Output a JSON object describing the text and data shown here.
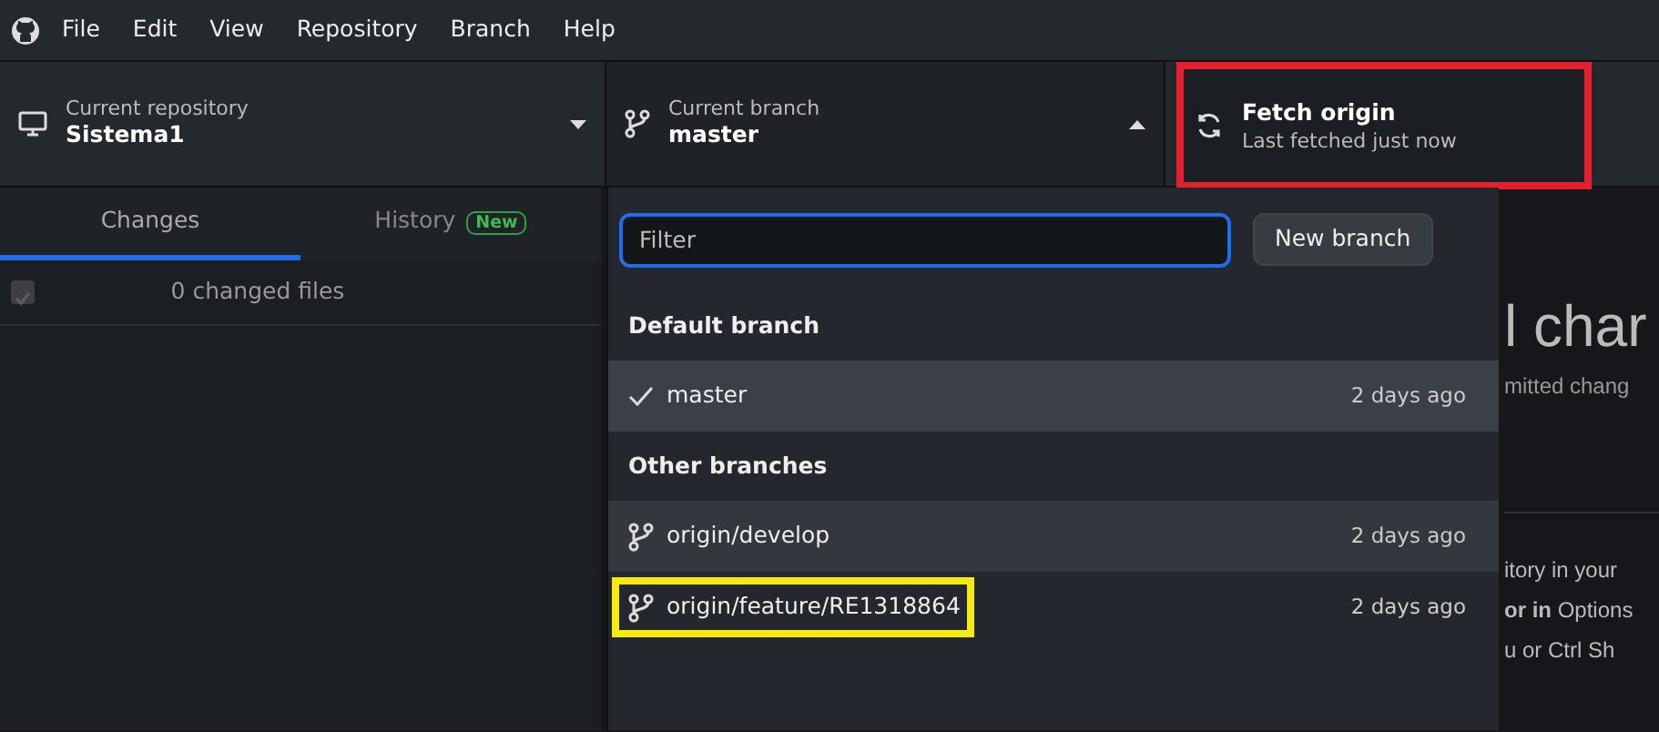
{
  "menu": [
    "File",
    "Edit",
    "View",
    "Repository",
    "Branch",
    "Help"
  ],
  "toolbar": {
    "repository": {
      "label": "Current repository",
      "value": "Sistema1"
    },
    "branch": {
      "label": "Current branch",
      "value": "master",
      "expanded": true
    },
    "fetch": {
      "title": "Fetch origin",
      "subtitle": "Last fetched just now",
      "highlighted": true
    }
  },
  "tabs": [
    {
      "label": "Changes",
      "selected": true
    },
    {
      "label": "History",
      "badge": "New",
      "selected": false
    }
  ],
  "changes": {
    "summary": "0 changed files",
    "checked": true,
    "disabled": true
  },
  "branch_menu": {
    "filter_placeholder": "Filter",
    "new_button": "New branch",
    "groups": [
      {
        "header": "Default branch",
        "items": [
          {
            "name": "master",
            "time": "2 days ago",
            "current": true,
            "selected": true
          }
        ]
      },
      {
        "header": "Other branches",
        "items": [
          {
            "name": "origin/develop",
            "time": "2 days ago",
            "current": false,
            "selected": false,
            "hovered": true
          },
          {
            "name": "origin/feature/RE1318864",
            "time": "2 days ago",
            "current": false,
            "selected": false,
            "highlighted": true
          }
        ]
      }
    ]
  },
  "background": {
    "heading": "l char",
    "subtitle": "mitted chang",
    "lines": [
      "itory in your",
      "**or in** Options",
      "u or Ctrl Sh"
    ]
  }
}
